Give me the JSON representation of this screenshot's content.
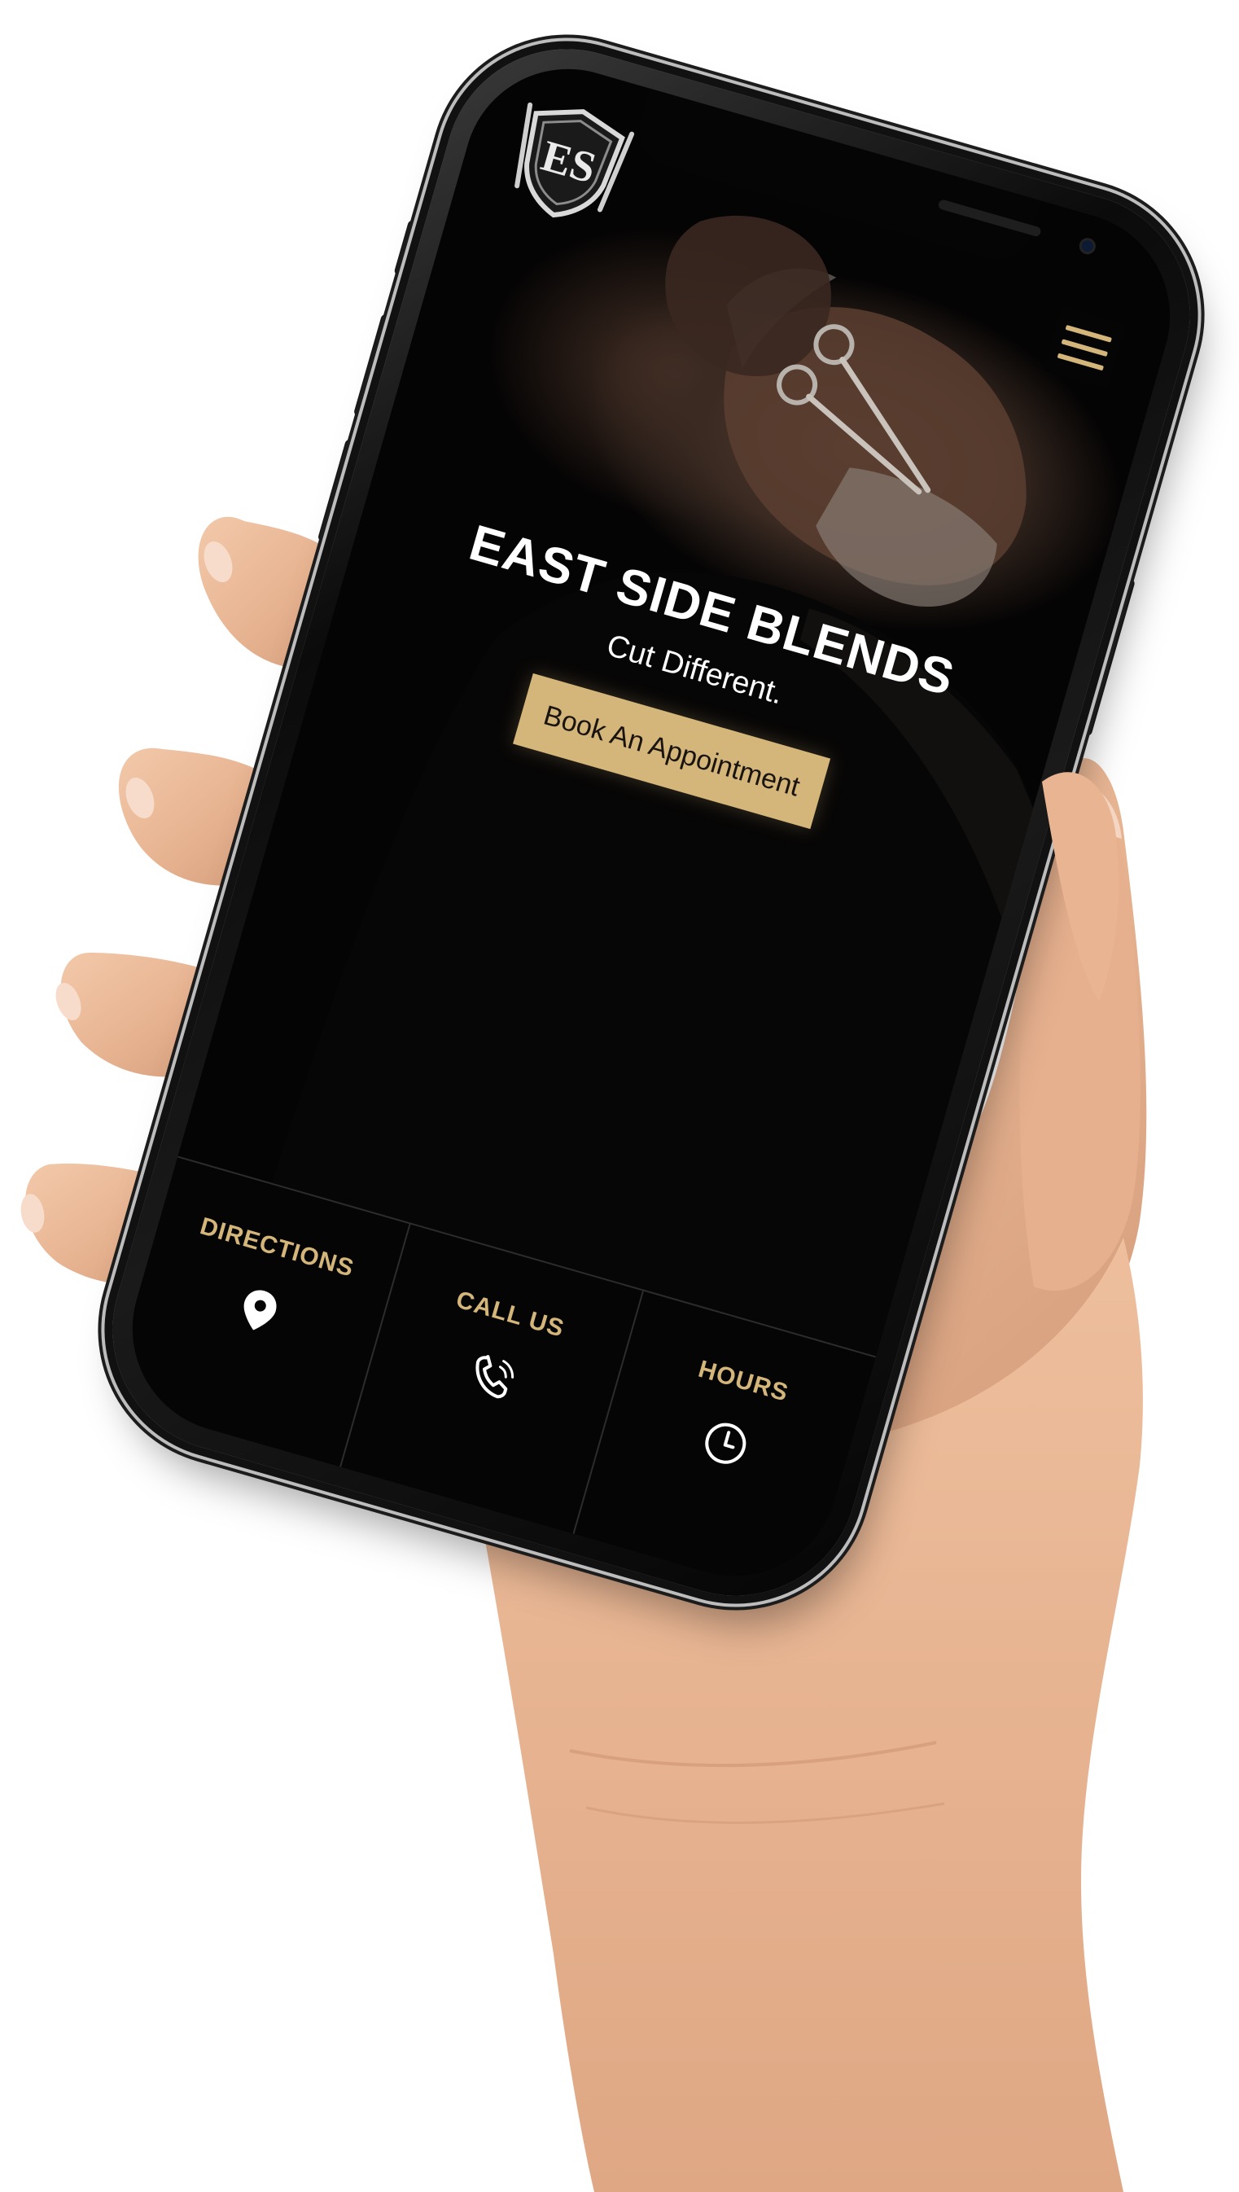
{
  "brand": {
    "name": "EAST SIDE BLENDS",
    "tagline": "Cut Different.",
    "logo_text": "ES",
    "accent_color": "#d4b57a",
    "background_color": "#050505"
  },
  "header": {
    "menu_icon": "hamburger-menu-icon"
  },
  "hero": {
    "cta_label": "Book An Appointment"
  },
  "bottom_nav": {
    "items": [
      {
        "label": "DIRECTIONS",
        "icon": "map-pin-icon"
      },
      {
        "label": "CALL US",
        "icon": "phone-icon"
      },
      {
        "label": "HOURS",
        "icon": "clock-icon"
      }
    ]
  }
}
